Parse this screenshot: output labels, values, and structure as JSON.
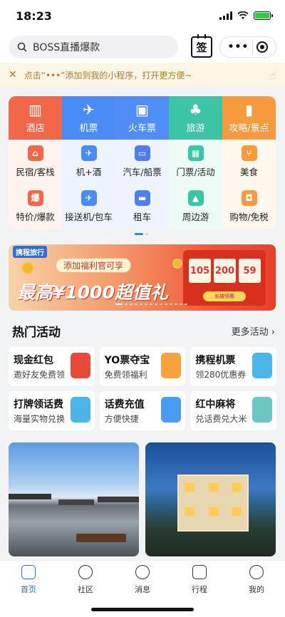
{
  "status": {
    "time": "18:23"
  },
  "search": {
    "placeholder": "BOSS直播爆款"
  },
  "header": {
    "sign_label": "签",
    "capsule_more": "•••"
  },
  "tip": {
    "text": "点击“•••”添加到我的小程序，打开更方便~"
  },
  "main_tiles": [
    {
      "label": "酒店",
      "color": "#f2664a",
      "icon": "hotel-icon"
    },
    {
      "label": "机票",
      "color": "#4a8cf5",
      "icon": "plane-icon"
    },
    {
      "label": "火车票",
      "color": "#4f8df7",
      "icon": "train-icon"
    },
    {
      "label": "旅游",
      "color": "#3cc5a4",
      "icon": "palm-tree-icon"
    },
    {
      "label": "攻略/景点",
      "color": "#f79a3d",
      "icon": "guide-book-icon"
    }
  ],
  "sub_tiles": [
    [
      {
        "label": "民宿/客栈",
        "color": "#f2664a",
        "icon": "house-icon"
      },
      {
        "label": "特价/爆款",
        "color": "#f2664a",
        "icon": "fire-icon"
      }
    ],
    [
      {
        "label": "机+酒",
        "color": "#4a8cf5",
        "icon": "plane-hotel-icon"
      },
      {
        "label": "接送机/包车",
        "color": "#4a8cf5",
        "icon": "car-transfer-icon"
      }
    ],
    [
      {
        "label": "汽车/船票",
        "color": "#4f7df0",
        "icon": "bus-icon"
      },
      {
        "label": "租车",
        "color": "#4f7df0",
        "icon": "rental-car-icon"
      }
    ],
    [
      {
        "label": "门票/活动",
        "color": "#3cc5a4",
        "icon": "ticket-icon"
      },
      {
        "label": "周边游",
        "color": "#3cc5a4",
        "icon": "mountain-icon"
      }
    ],
    [
      {
        "label": "美食",
        "color": "#f79a3d",
        "icon": "fork-knife-icon"
      },
      {
        "label": "购物/免税",
        "color": "#f79a3d",
        "icon": "shopping-bag-icon"
      }
    ]
  ],
  "banner": {
    "brand": "携程旅行",
    "pill": "添加福利官可享",
    "headline": "最高¥1000超值礼",
    "coupons": [
      "105",
      "200",
      "59"
    ],
    "button": "长按领券"
  },
  "activities_section": {
    "title": "热门活动",
    "more": "更多活动 ›"
  },
  "activities": [
    {
      "title": "现金红包",
      "subtitle": "邀好友免费领",
      "color": "#e84a3a",
      "icon": "red-envelope-icon"
    },
    {
      "title": "YO票夺宝",
      "subtitle": "免费领福利",
      "color": "#f7a23a",
      "icon": "ticket-coupon-icon"
    },
    {
      "title": "携程机票",
      "subtitle": "领280优惠券",
      "color": "#4ab6e8",
      "icon": "dolphin-mascot-icon"
    },
    {
      "title": "打牌领话费",
      "subtitle": "海量实物兑换",
      "color": "#4ab6e8",
      "icon": "cards-mascot-icon"
    },
    {
      "title": "话费充值",
      "subtitle": "方便快捷",
      "color": "#4a9cf0",
      "icon": "phone-recharge-icon"
    },
    {
      "title": "红中麻将",
      "subtitle": "兑话费兑大米",
      "color": "#6bc7c0",
      "icon": "mahjong-mascot-icon"
    }
  ],
  "tabs": [
    {
      "label": "首页",
      "active": true,
      "icon": "home-icon"
    },
    {
      "label": "社区",
      "active": false,
      "icon": "planet-icon"
    },
    {
      "label": "消息",
      "active": false,
      "icon": "chat-icon"
    },
    {
      "label": "行程",
      "active": false,
      "icon": "calendar-icon"
    },
    {
      "label": "我的",
      "active": false,
      "icon": "user-icon"
    }
  ]
}
